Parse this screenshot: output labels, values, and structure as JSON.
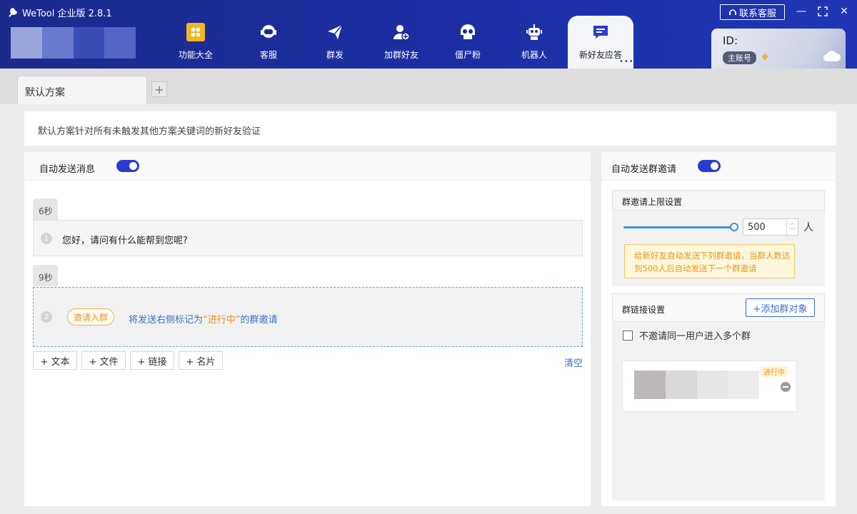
{
  "app": {
    "title": "WeTool 企业版 2.8.1",
    "contact_label": "联系客服"
  },
  "nav": {
    "items": [
      {
        "label": "功能大全",
        "icon": "grid-icon"
      },
      {
        "label": "客服",
        "icon": "headset-icon"
      },
      {
        "label": "群发",
        "icon": "paper-plane-icon"
      },
      {
        "label": "加群好友",
        "icon": "add-user-icon"
      },
      {
        "label": "僵尸粉",
        "icon": "skull-icon"
      },
      {
        "label": "机器人",
        "icon": "robot-icon"
      },
      {
        "label": "新好友应答",
        "icon": "chat-bubble-icon",
        "active": true
      }
    ],
    "more_dots": "•••"
  },
  "account": {
    "id_label": "ID:",
    "role_badge": "主账号",
    "diamond": "◆"
  },
  "tabs": {
    "items": [
      {
        "label": "默认方案"
      }
    ],
    "add_label": "+"
  },
  "description": "默认方案针对所有未触发其他方案关键词的新好友验证",
  "auto_message": {
    "title": "自动发送消息",
    "enabled": true,
    "messages": [
      {
        "delay": "6秒",
        "index": "1",
        "text": "您好，请问有什么能帮到您呢?"
      },
      {
        "delay": "9秒",
        "index": "2",
        "pill": "邀请入群",
        "text_before": "将发送右侧标记为",
        "text_highlight": "“进行中”",
        "text_after": "的群邀请"
      }
    ],
    "add_buttons": [
      "+ 文本",
      "+ 文件",
      "+ 链接",
      "+ 名片"
    ],
    "clear_label": "清空"
  },
  "group_invite": {
    "title": "自动发送群邀请",
    "enabled": true,
    "limit_section": {
      "title": "群邀请上限设置",
      "value": "500",
      "unit": "人",
      "hint": "给新好友自动发送下列群邀请，当群人数达到500人后自动发送下一个群邀请"
    },
    "link_section": {
      "title": "群链接设置",
      "add_button": "+添加群对象",
      "checkbox_label": "不邀请同一用户进入多个群",
      "checkbox_checked": false
    },
    "group_card": {
      "status": "进行中"
    }
  },
  "colors": {
    "accent": "#2a3ccf",
    "header": "#1b2fa4",
    "warning": "#e59820",
    "link": "#3a6fd0"
  }
}
